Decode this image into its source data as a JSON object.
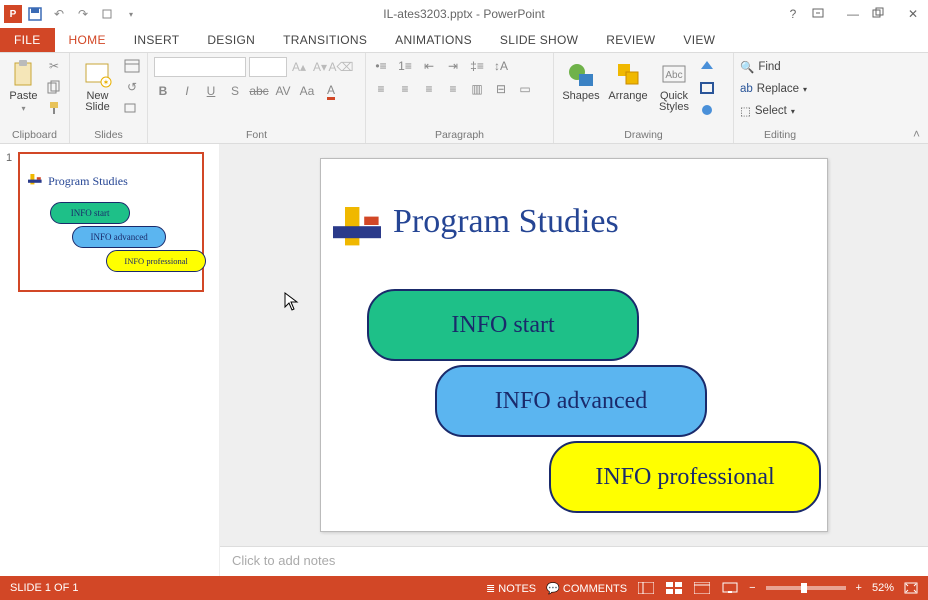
{
  "titlebar": {
    "title": "IL-ates3203.pptx - PowerPoint"
  },
  "tabs": {
    "file": "FILE",
    "home": "HOME",
    "insert": "INSERT",
    "design": "DESIGN",
    "transitions": "TRANSITIONS",
    "animations": "ANIMATIONS",
    "slideshow": "SLIDE SHOW",
    "review": "REVIEW",
    "view": "VIEW"
  },
  "ribbon": {
    "clipboard": {
      "paste": "Paste",
      "label": "Clipboard"
    },
    "slides": {
      "newslide": "New\nSlide",
      "label": "Slides"
    },
    "font": {
      "label": "Font"
    },
    "paragraph": {
      "label": "Paragraph"
    },
    "drawing": {
      "shapes": "Shapes",
      "arrange": "Arrange",
      "quick": "Quick\nStyles",
      "label": "Drawing"
    },
    "editing": {
      "find": "Find",
      "replace": "Replace",
      "select": "Select",
      "label": "Editing"
    }
  },
  "slide": {
    "number": "1",
    "title": "Program Studies",
    "shape1": "INFO start",
    "shape2": "INFO advanced",
    "shape3": "INFO professional"
  },
  "notes_placeholder": "Click to add notes",
  "status": {
    "slide_info": "SLIDE 1 OF 1",
    "notes": "NOTES",
    "comments": "COMMENTS",
    "zoom": "52%"
  }
}
